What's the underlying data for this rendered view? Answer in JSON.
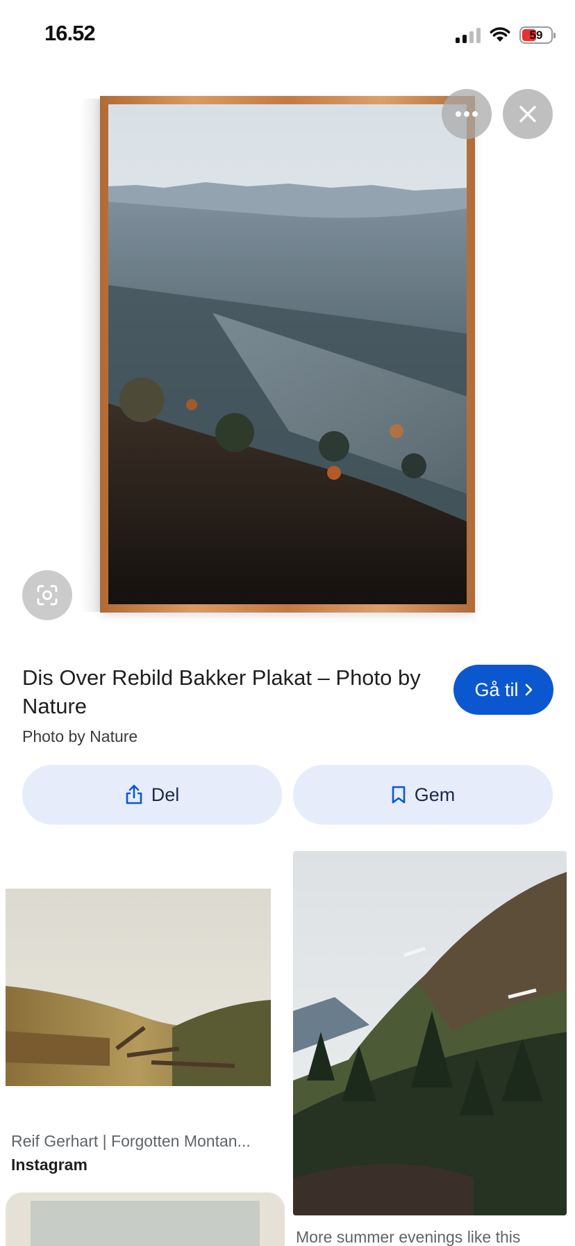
{
  "status_bar": {
    "time": "16.52",
    "battery": "59"
  },
  "hero": {
    "title": "Dis Over Rebild Bakker Plakat – Photo by Nature",
    "source": "Photo by Nature",
    "goto_label": "Gå til",
    "share_label": "Del",
    "save_label": "Gem",
    "frame_color": "#c98a52",
    "accent_color": "#0b57d0"
  },
  "results": [
    {
      "title": "Reif Gerhart | Forgotten Montan...",
      "source": "Instagram"
    },
    {
      "title": "More summer evenings like this"
    }
  ]
}
